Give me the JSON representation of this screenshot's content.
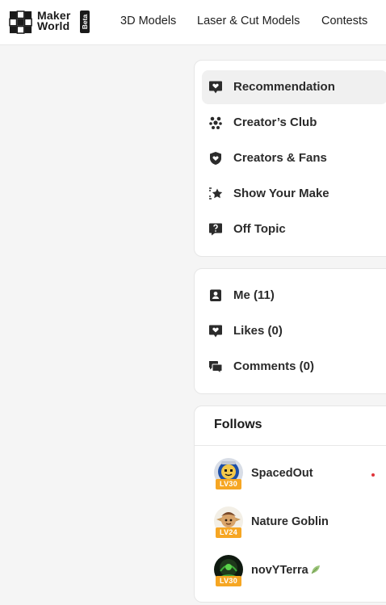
{
  "header": {
    "logo": {
      "line1": "Maker",
      "line2": "World",
      "badge": "Beta"
    },
    "nav": [
      {
        "label": "3D Models"
      },
      {
        "label": "Laser & Cut Models"
      },
      {
        "label": "Contests"
      }
    ]
  },
  "categories": {
    "items": [
      {
        "label": "Recommendation",
        "icon": "heart-bubble-icon",
        "active": true
      },
      {
        "label": "Creator’s Club",
        "icon": "club-dots-icon",
        "active": false
      },
      {
        "label": "Creators & Fans",
        "icon": "heart-shield-icon",
        "active": false
      },
      {
        "label": "Show Your Make",
        "icon": "star-frame-icon",
        "active": false
      },
      {
        "label": "Off Topic",
        "icon": "question-bubble-icon",
        "active": false
      }
    ]
  },
  "me_section": {
    "items": [
      {
        "label": "Me (11)",
        "icon": "user-badge-icon"
      },
      {
        "label": "Likes (0)",
        "icon": "like-bubble-icon"
      },
      {
        "label": "Comments (0)",
        "icon": "comments-icon"
      }
    ]
  },
  "follows": {
    "title": "Follows",
    "users": [
      {
        "name": "SpacedOut",
        "level": "LV30",
        "avatar": "astronaut-avatar",
        "unread": true
      },
      {
        "name": "Nature Goblin",
        "level": "LV24",
        "avatar": "goblin-avatar",
        "unread": false
      },
      {
        "name": "novYTerra",
        "level": "LV30",
        "avatar": "terra-avatar",
        "badge_icon": "leaf-icon",
        "unread": false
      }
    ]
  },
  "colors": {
    "accent_level": "#f6a623",
    "unread_dot": "#e0353b",
    "active_bg": "#f0f0f0"
  }
}
